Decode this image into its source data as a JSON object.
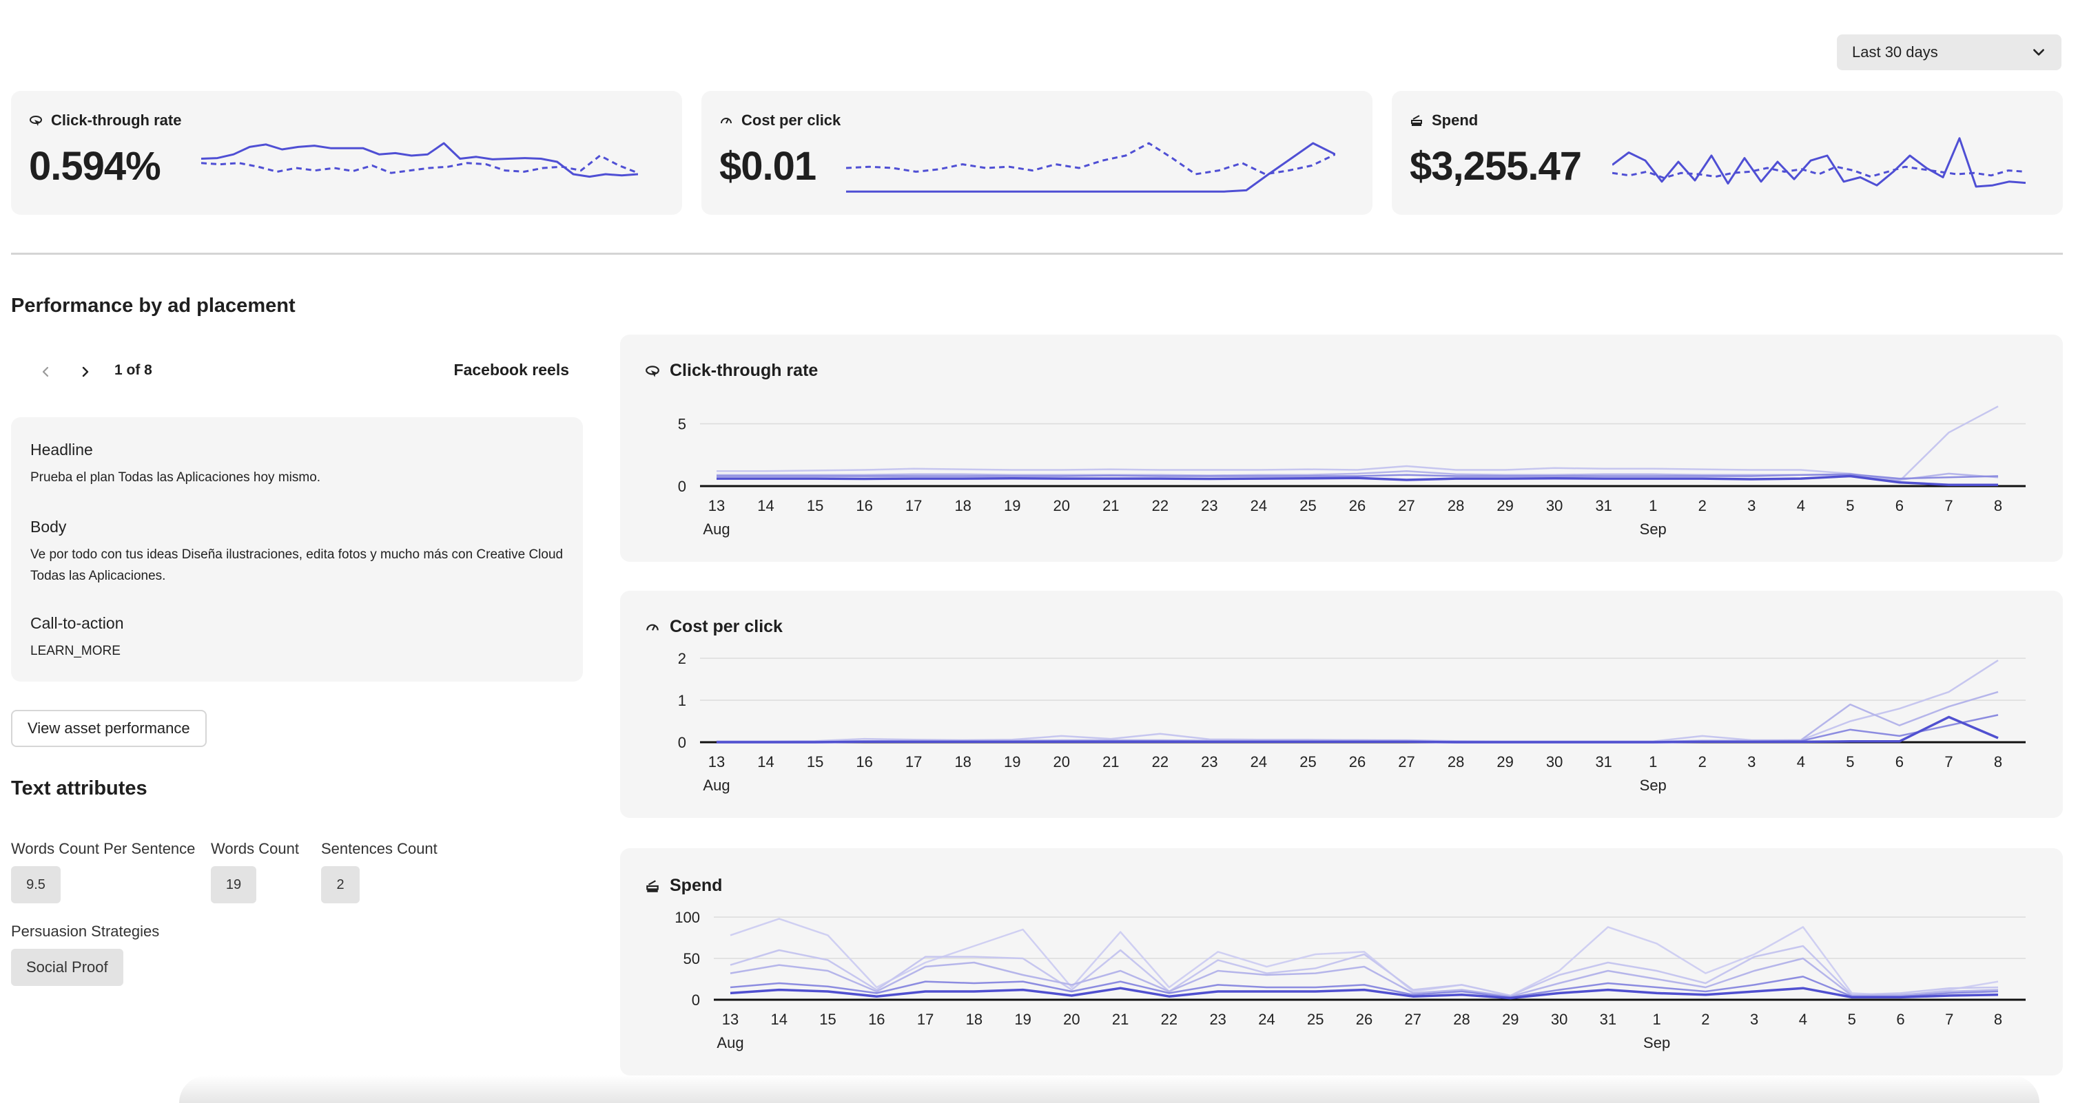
{
  "date_range": {
    "selected": "Last 30 days"
  },
  "kpis": [
    {
      "label": "Click-through rate",
      "value": "0.594%",
      "icon": "click-icon"
    },
    {
      "label": "Cost per click",
      "value": "$0.01",
      "icon": "gauge-icon"
    },
    {
      "label": "Spend",
      "value": "$3,255.47",
      "icon": "money-stack-icon"
    }
  ],
  "sparklines": {
    "ctr": {
      "solid": [
        0.55,
        0.56,
        0.62,
        0.74,
        0.78,
        0.7,
        0.74,
        0.76,
        0.72,
        0.72,
        0.72,
        0.62,
        0.64,
        0.6,
        0.62,
        0.8,
        0.55,
        0.58,
        0.54,
        0.55,
        0.56,
        0.55,
        0.5,
        0.3,
        0.26,
        0.3,
        0.28,
        0.3
      ],
      "dashed": [
        0.48,
        0.46,
        0.48,
        0.42,
        0.34,
        0.4,
        0.36,
        0.4,
        0.35,
        0.44,
        0.32,
        0.36,
        0.4,
        0.42,
        0.48,
        0.46,
        0.36,
        0.34,
        0.4,
        0.42,
        0.36,
        0.6,
        0.44,
        0.32
      ]
    },
    "cpc": {
      "solid": [
        0.02,
        0.02,
        0.02,
        0.02,
        0.02,
        0.02,
        0.02,
        0.02,
        0.02,
        0.02,
        0.02,
        0.02,
        0.02,
        0.02,
        0.02,
        0.02,
        0.02,
        0.02,
        0.04,
        0.3,
        0.55,
        0.8,
        0.62
      ],
      "dashed": [
        0.4,
        0.42,
        0.4,
        0.34,
        0.38,
        0.46,
        0.4,
        0.42,
        0.36,
        0.46,
        0.4,
        0.52,
        0.6,
        0.8,
        0.56,
        0.3,
        0.36,
        0.48,
        0.3,
        0.36,
        0.44,
        0.62
      ]
    },
    "spend": {
      "solid": [
        0.45,
        0.65,
        0.52,
        0.18,
        0.5,
        0.2,
        0.6,
        0.15,
        0.56,
        0.18,
        0.5,
        0.22,
        0.52,
        0.6,
        0.18,
        0.25,
        0.12,
        0.34,
        0.6,
        0.4,
        0.25,
        0.88,
        0.1,
        0.12,
        0.18,
        0.16
      ],
      "dashed": [
        0.32,
        0.28,
        0.34,
        0.24,
        0.32,
        0.3,
        0.26,
        0.32,
        0.34,
        0.4,
        0.34,
        0.38,
        0.3,
        0.42,
        0.36,
        0.26,
        0.34,
        0.42,
        0.38,
        0.34,
        0.3,
        0.32,
        0.28,
        0.36,
        0.34
      ]
    }
  },
  "section_title": "Performance by ad placement",
  "pager": {
    "text": "1 of 8",
    "placement": "Facebook reels"
  },
  "ad": {
    "headline_label": "Headline",
    "headline": "Prueba el plan Todas las Aplicaciones hoy mismo.",
    "body_label": "Body",
    "body": "Ve por todo con tus ideas Diseña ilustraciones, edita fotos y mucho más con Creative Cloud Todas las Aplicaciones.",
    "cta_label": "Call-to-action",
    "cta": "LEARN_MORE"
  },
  "asset_button": "View asset performance",
  "text_attributes": {
    "title": "Text attributes",
    "items": [
      {
        "label": "Words Count Per Sentence",
        "value": "9.5"
      },
      {
        "label": "Words Count",
        "value": "19"
      },
      {
        "label": "Sentences Count",
        "value": "2"
      }
    ],
    "strategy_label": "Persuasion Strategies",
    "strategy_value": "Social Proof"
  },
  "colors": {
    "accent": "#4f4fd4",
    "faint": "#c9c9f0",
    "card": "#f5f5f5"
  },
  "chart_data": [
    {
      "type": "line",
      "title": "Click-through rate",
      "x": [
        "13",
        "14",
        "15",
        "16",
        "17",
        "18",
        "19",
        "20",
        "21",
        "22",
        "23",
        "24",
        "25",
        "26",
        "27",
        "28",
        "29",
        "30",
        "31",
        "1",
        "2",
        "3",
        "4",
        "5",
        "6",
        "7",
        "8"
      ],
      "month_labels": [
        {
          "index": 0,
          "text": "Aug"
        },
        {
          "index": 19,
          "text": "Sep"
        }
      ],
      "yticks": [
        0,
        5
      ],
      "ylim": [
        0,
        6.3
      ],
      "series": [
        {
          "values": [
            1.2,
            1.2,
            1.25,
            1.3,
            1.4,
            1.35,
            1.3,
            1.3,
            1.35,
            1.3,
            1.3,
            1.3,
            1.35,
            1.3,
            1.6,
            1.3,
            1.3,
            1.45,
            1.4,
            1.4,
            1.35,
            1.3,
            1.3,
            1.0,
            0.4,
            4.3,
            6.4
          ]
        },
        {
          "values": [
            0.9,
            0.9,
            0.9,
            0.9,
            0.95,
            0.95,
            0.9,
            0.9,
            0.9,
            0.9,
            0.85,
            0.9,
            0.9,
            1.0,
            1.2,
            0.95,
            0.9,
            0.9,
            0.95,
            0.95,
            0.9,
            0.9,
            0.9,
            0.9,
            0.5,
            1.0,
            0.7
          ]
        },
        {
          "values": [
            0.8,
            0.8,
            0.8,
            0.8,
            0.8,
            0.8,
            0.8,
            0.8,
            0.85,
            0.8,
            0.8,
            0.8,
            0.8,
            0.8,
            0.9,
            0.8,
            0.8,
            0.8,
            0.8,
            0.8,
            0.8,
            0.8,
            0.9,
            0.95,
            0.6,
            0.7,
            0.8
          ]
        },
        {
          "values": [
            0.6,
            0.6,
            0.6,
            0.58,
            0.6,
            0.6,
            0.62,
            0.6,
            0.6,
            0.6,
            0.58,
            0.6,
            0.62,
            0.65,
            0.5,
            0.6,
            0.6,
            0.62,
            0.6,
            0.6,
            0.6,
            0.55,
            0.6,
            0.8,
            0.3,
            0.1,
            0.1
          ]
        }
      ]
    },
    {
      "type": "line",
      "title": "Cost per click",
      "x": [
        "13",
        "14",
        "15",
        "16",
        "17",
        "18",
        "19",
        "20",
        "21",
        "22",
        "23",
        "24",
        "25",
        "26",
        "27",
        "28",
        "29",
        "30",
        "31",
        "1",
        "2",
        "3",
        "4",
        "5",
        "6",
        "7",
        "8"
      ],
      "month_labels": [
        {
          "index": 0,
          "text": "Aug"
        },
        {
          "index": 19,
          "text": "Sep"
        }
      ],
      "yticks": [
        0,
        1,
        2
      ],
      "ylim": [
        0,
        2.1
      ],
      "series": [
        {
          "values": [
            0.02,
            0.02,
            0.03,
            0.08,
            0.06,
            0.05,
            0.06,
            0.15,
            0.08,
            0.2,
            0.07,
            0.06,
            0.06,
            0.05,
            0.05,
            0.03,
            0.02,
            0.02,
            0.02,
            0.02,
            0.15,
            0.05,
            0.05,
            0.5,
            0.8,
            1.2,
            1.95
          ]
        },
        {
          "values": [
            0.02,
            0.02,
            0.02,
            0.03,
            0.04,
            0.04,
            0.04,
            0.05,
            0.05,
            0.05,
            0.04,
            0.04,
            0.04,
            0.05,
            0.04,
            0.02,
            0.02,
            0.02,
            0.02,
            0.02,
            0.04,
            0.04,
            0.05,
            0.9,
            0.4,
            0.85,
            1.2
          ]
        },
        {
          "values": [
            0.01,
            0.01,
            0.01,
            0.02,
            0.02,
            0.02,
            0.02,
            0.03,
            0.03,
            0.03,
            0.02,
            0.02,
            0.02,
            0.02,
            0.02,
            0.01,
            0.01,
            0.01,
            0.01,
            0.01,
            0.02,
            0.02,
            0.03,
            0.3,
            0.15,
            0.4,
            0.65
          ]
        },
        {
          "values": [
            0.0,
            0.0,
            0.0,
            0.01,
            0.01,
            0.01,
            0.01,
            0.01,
            0.01,
            0.01,
            0.01,
            0.01,
            0.01,
            0.01,
            0.01,
            0.0,
            0.0,
            0.0,
            0.0,
            0.0,
            0.01,
            0.01,
            0.01,
            0.02,
            0.02,
            0.6,
            0.1
          ]
        }
      ]
    },
    {
      "type": "line",
      "title": "Spend",
      "x": [
        "13",
        "14",
        "15",
        "16",
        "17",
        "18",
        "19",
        "20",
        "21",
        "22",
        "23",
        "24",
        "25",
        "26",
        "27",
        "28",
        "29",
        "30",
        "31",
        "1",
        "2",
        "3",
        "4",
        "5",
        "6",
        "7",
        "8"
      ],
      "month_labels": [
        {
          "index": 0,
          "text": "Aug"
        },
        {
          "index": 19,
          "text": "Sep"
        }
      ],
      "yticks": [
        0,
        50,
        100
      ],
      "ylim": [
        0,
        105
      ],
      "series": [
        {
          "values": [
            78,
            98,
            78,
            15,
            45,
            65,
            85,
            15,
            82,
            15,
            58,
            40,
            55,
            58,
            10,
            18,
            5,
            35,
            88,
            68,
            32,
            55,
            88,
            8,
            5,
            12,
            22
          ]
        },
        {
          "values": [
            42,
            60,
            48,
            12,
            52,
            52,
            50,
            12,
            60,
            10,
            48,
            32,
            38,
            55,
            12,
            18,
            5,
            30,
            45,
            35,
            20,
            52,
            65,
            6,
            8,
            14,
            15
          ]
        },
        {
          "values": [
            32,
            42,
            35,
            10,
            40,
            45,
            30,
            18,
            35,
            10,
            35,
            30,
            32,
            40,
            8,
            12,
            4,
            20,
            35,
            25,
            15,
            35,
            50,
            5,
            6,
            10,
            12
          ]
        },
        {
          "values": [
            15,
            20,
            16,
            8,
            22,
            20,
            22,
            10,
            22,
            8,
            18,
            15,
            15,
            18,
            6,
            10,
            3,
            12,
            20,
            15,
            10,
            18,
            28,
            4,
            4,
            8,
            10
          ]
        },
        {
          "values": [
            8,
            12,
            10,
            4,
            10,
            10,
            12,
            5,
            14,
            4,
            10,
            10,
            10,
            12,
            4,
            6,
            2,
            8,
            12,
            8,
            6,
            10,
            14,
            3,
            3,
            5,
            6
          ]
        }
      ]
    }
  ]
}
